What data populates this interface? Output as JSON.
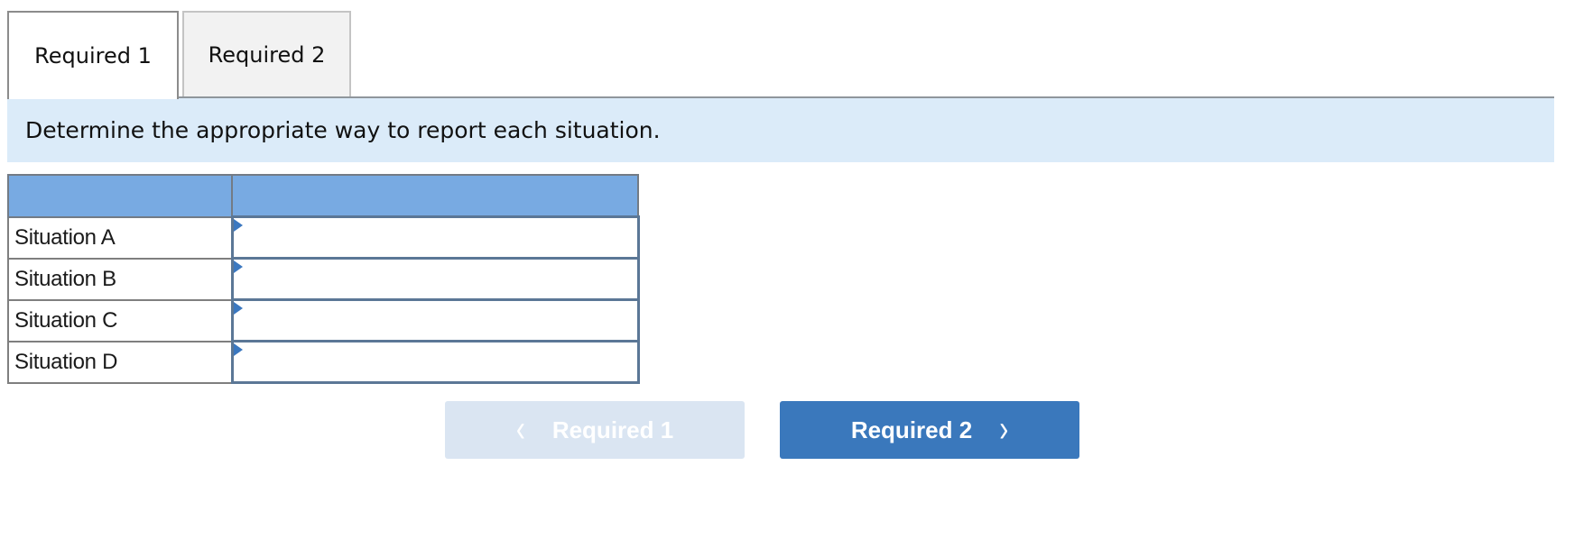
{
  "tabs": [
    {
      "label": "Required 1",
      "active": true
    },
    {
      "label": "Required 2",
      "active": false
    }
  ],
  "instruction": "Determine the appropriate way to report each situation.",
  "table": {
    "headers": [
      "",
      ""
    ],
    "rows": [
      {
        "label": "Situation A",
        "value": ""
      },
      {
        "label": "Situation B",
        "value": ""
      },
      {
        "label": "Situation C",
        "value": ""
      },
      {
        "label": "Situation D",
        "value": ""
      }
    ]
  },
  "nav": {
    "prev": {
      "label": "Required 1",
      "icon": "chevron-left-icon",
      "glyph": "‹",
      "disabled": true
    },
    "next": {
      "label": "Required 2",
      "icon": "chevron-right-icon",
      "glyph": "›",
      "disabled": false
    }
  },
  "colors": {
    "header_blue": "#78aae2",
    "instruction_bg": "#dbebf9",
    "primary_button": "#3a78bc",
    "disabled_button": "#dae5f2"
  }
}
